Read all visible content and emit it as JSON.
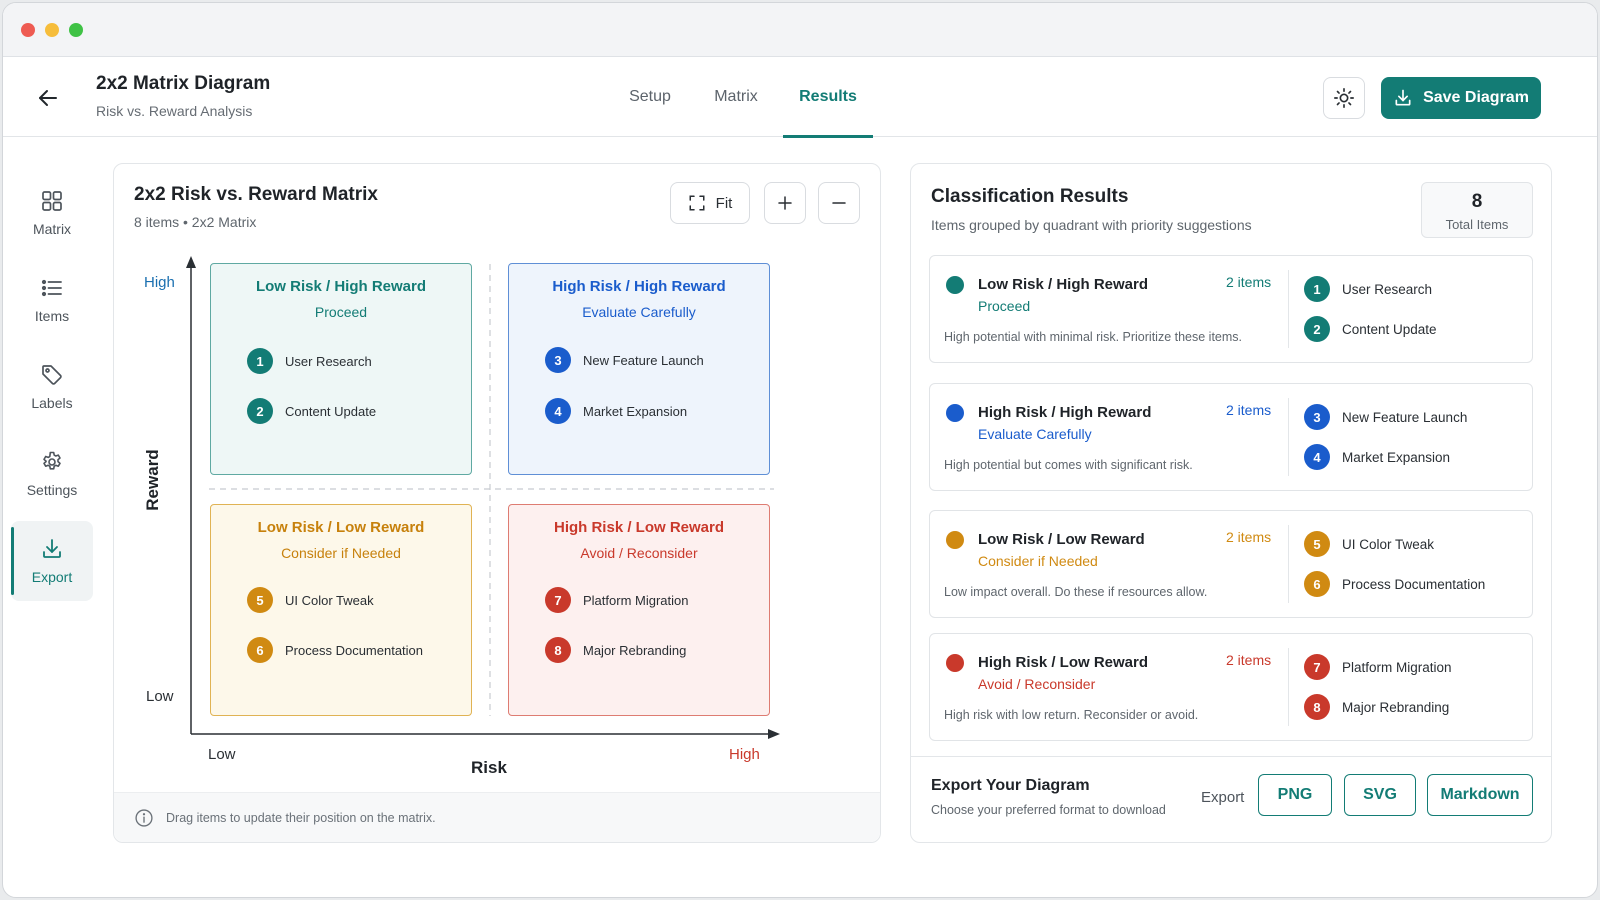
{
  "window": {
    "controls": [
      "close",
      "minimize",
      "maximize"
    ]
  },
  "header": {
    "title": "2x2 Matrix Diagram",
    "subtitle": "Risk vs. Reward Analysis",
    "tabs": [
      {
        "label": "Setup",
        "active": false
      },
      {
        "label": "Matrix",
        "active": false
      },
      {
        "label": "Results",
        "active": true
      }
    ],
    "save_label": "Save Diagram",
    "icons": {
      "back": "arrow-left-icon",
      "theme": "sun-icon",
      "save": "download-icon"
    }
  },
  "sidebar": {
    "items": [
      {
        "label": "Matrix",
        "icon": "grid-icon",
        "active": false
      },
      {
        "label": "Items",
        "icon": "list-icon",
        "active": false
      },
      {
        "label": "Labels",
        "icon": "tag-icon",
        "active": false
      },
      {
        "label": "Settings",
        "icon": "gear-icon",
        "active": false
      },
      {
        "label": "Export",
        "icon": "download-icon",
        "active": true
      }
    ]
  },
  "matrix": {
    "title": "2x2 Risk vs. Reward Matrix",
    "subtitle": "8 items • 2x2 Matrix",
    "fit_label": "Fit",
    "y_axis": {
      "label": "Reward",
      "high": "High",
      "low": "Low"
    },
    "x_axis": {
      "label": "Risk",
      "low": "Low",
      "high": "High"
    },
    "quadrants": [
      {
        "title": "Low Risk / High Reward",
        "subtitle": "Proceed",
        "color": "#137c75",
        "items": [
          {
            "num": "1",
            "label": "User Research"
          },
          {
            "num": "2",
            "label": "Content Update"
          }
        ]
      },
      {
        "title": "High Risk / High Reward",
        "subtitle": "Evaluate Carefully",
        "color": "#1a5ccc",
        "items": [
          {
            "num": "3",
            "label": "New Feature Launch"
          },
          {
            "num": "4",
            "label": "Market Expansion"
          }
        ]
      },
      {
        "title": "Low Risk / Low Reward",
        "subtitle": "Consider if Needed",
        "color": "#d08a12",
        "items": [
          {
            "num": "5",
            "label": "UI Color Tweak"
          },
          {
            "num": "6",
            "label": "Process Documentation"
          }
        ]
      },
      {
        "title": "High Risk / Low Reward",
        "subtitle": "Avoid / Reconsider",
        "color": "#c9392b",
        "items": [
          {
            "num": "7",
            "label": "Platform Migration"
          },
          {
            "num": "8",
            "label": "Major Rebranding"
          }
        ]
      }
    ],
    "hint": "Drag items to update their position on the matrix."
  },
  "results": {
    "title": "Classification Results",
    "subtitle": "Items grouped by quadrant with priority suggestions",
    "total": {
      "value": "8",
      "label": "Total Items"
    },
    "cards": [
      {
        "title": "Low Risk / High Reward",
        "subtitle": "Proceed",
        "count": "2 items",
        "color": "#137c75",
        "description": "High potential with minimal risk. Prioritize these items.",
        "items": [
          {
            "num": "1",
            "label": "User Research"
          },
          {
            "num": "2",
            "label": "Content Update"
          }
        ]
      },
      {
        "title": "High Risk / High Reward",
        "subtitle": "Evaluate Carefully",
        "count": "2 items",
        "color": "#1a5ccc",
        "description": "High potential but comes with significant risk.",
        "items": [
          {
            "num": "3",
            "label": "New Feature Launch"
          },
          {
            "num": "4",
            "label": "Market Expansion"
          }
        ]
      },
      {
        "title": "Low Risk / Low Reward",
        "subtitle": "Consider if Needed",
        "count": "2 items",
        "color": "#d08a12",
        "description": "Low impact overall. Do these if resources allow.",
        "items": [
          {
            "num": "5",
            "label": "UI Color Tweak"
          },
          {
            "num": "6",
            "label": "Process Documentation"
          }
        ]
      },
      {
        "title": "High Risk / Low Reward",
        "subtitle": "Avoid / Reconsider",
        "count": "2 items",
        "color": "#c9392b",
        "description": "High risk with low return. Reconsider or avoid.",
        "items": [
          {
            "num": "7",
            "label": "Platform Migration"
          },
          {
            "num": "8",
            "label": "Major Rebranding"
          }
        ]
      }
    ],
    "export": {
      "title": "Export Your Diagram",
      "subtitle": "Choose your preferred format to download",
      "label": "Export",
      "formats": [
        "PNG",
        "SVG",
        "Markdown"
      ]
    }
  },
  "colors": {
    "accent": "#137c75",
    "teal": "#137c75",
    "blue": "#1a5ccc",
    "amber": "#d08a12",
    "red": "#c9392b"
  }
}
